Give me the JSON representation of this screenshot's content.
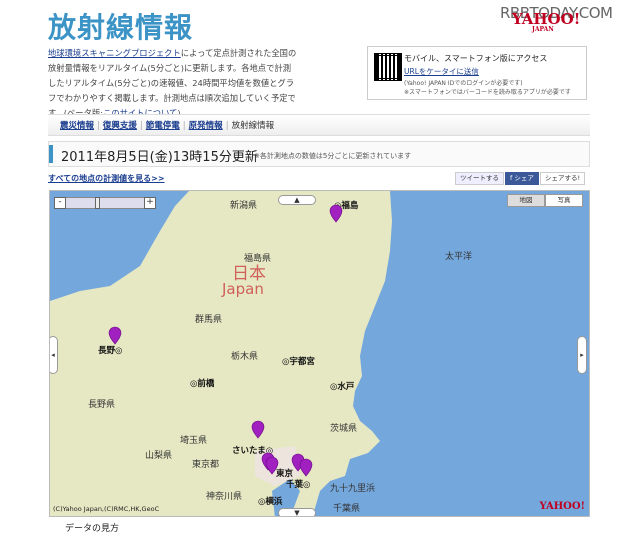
{
  "header": {
    "title": "放射線情報",
    "watermark": "RBBTODAY.COM",
    "logo": "YAHOO! JAPAN"
  },
  "intro": {
    "link1": "地球環境スキャニングプロジェクト",
    "text1": "によって定点計測された全国の放射量情報をリアルタイム(5分ごと)に更新します。各地点で計測したリアルタイム(5分ごと)の速報値、24時間平均値を数値とグラフでわかりやすく掲載します。計測地点は順次追加していく予定です。(ベータ版:",
    "link2": "このサイトについて",
    "text2": ")"
  },
  "mobile": {
    "title": "モバイル、スマートフォン版にアクセス",
    "send_link": "URLをケータイに送信",
    "note1": "(Yahoo! JAPAN IDでのログインが必要です)",
    "note2": "※スマートフォンではバーコードを読み取るアプリが必要です"
  },
  "nav": {
    "items": [
      "震災情報",
      "復興支援",
      "節電停電",
      "原発情報"
    ],
    "current": "放射線情報"
  },
  "update": {
    "datetime": "2011年8月5日(金)13時15分更新",
    "note": "※各計測地点の数値は5分ごとに更新されています"
  },
  "links": {
    "all_points": "すべての地点の計測値を見る>>"
  },
  "share": {
    "tweet": "ツイートする",
    "facebook": "f シェア",
    "share": "シェアする!"
  },
  "map": {
    "type_map": "地図",
    "type_photo": "写真",
    "credit": "(C)Yahoo Japan,(C)RMC,HK,GeoC",
    "logo": "YAHOO!",
    "labels": {
      "niigata": "新潟県",
      "fukushima_city": "◎福島",
      "pacific": "太平洋",
      "fukushima_pref": "福島県",
      "nihon": "日本",
      "japan": "Japan",
      "gunma": "群馬県",
      "nagano_city": "長野◎",
      "tochigi": "栃木県",
      "utsunomiya": "◎宇都宮",
      "maebashi": "◎前橋",
      "mito": "◎水戸",
      "nagano_pref": "長野県",
      "ibaraki": "茨城県",
      "saitama_pref": "埼玉県",
      "saitama_city": "さいたま◎",
      "yamanashi": "山梨県",
      "tokyo_pref": "東京都",
      "tokyo": "東京",
      "chiba_city": "千葉◎",
      "kanagawa": "神奈川県",
      "yokohama": "◎横浜",
      "kujukuri": "九十九里浜",
      "chiba_pref": "千葉県"
    },
    "pin_color": "#a020c0",
    "land_color": "#e6e8c4",
    "sea_color": "#74a7dc"
  },
  "footer": {
    "legend_heading": "データの見方"
  }
}
